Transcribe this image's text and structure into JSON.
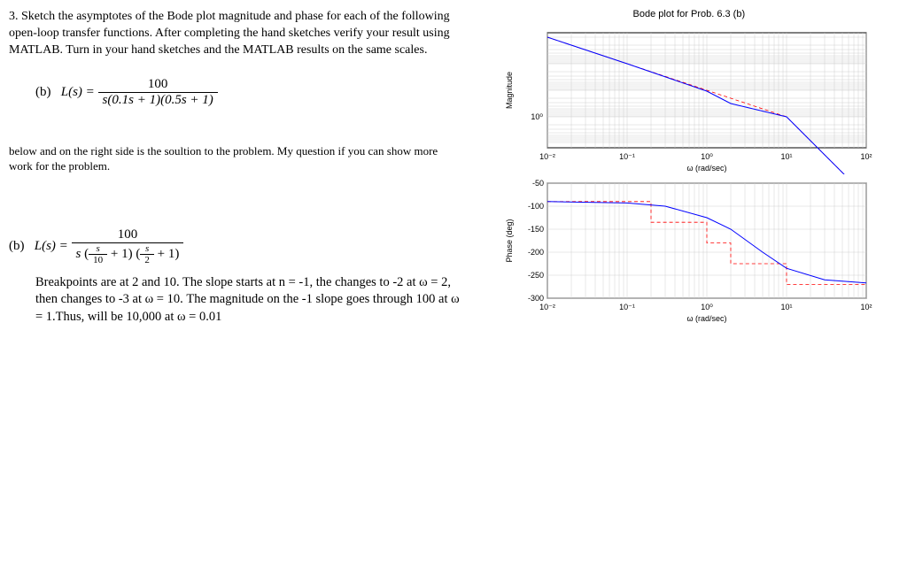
{
  "problem": {
    "number": "3.",
    "text": "Sketch the asymptotes of the Bode plot magnitude and phase for each of the following open-loop transfer functions. After completing the hand sketches verify your result using MATLAB. Turn in your hand sketches and the MATLAB results on the same scales.",
    "part_label": "(b)",
    "lhs": "L(s) = ",
    "numerator": "100",
    "denominator": "s(0.1s + 1)(0.5s + 1)"
  },
  "note": "below and on the right side is the soultion to the problem. My question if you can show more work for the problem.",
  "solution": {
    "part_label": "(b)",
    "lhs": "L(s) = ",
    "numerator": "100",
    "den_s": "s",
    "den_frac1_num": "s",
    "den_frac1_den": "10",
    "den_plus1_a": " + 1",
    "den_frac2_num": "s",
    "den_frac2_den": "2",
    "den_plus1_b": " + 1",
    "text": "Breakpoints are at 2 and 10.  The slope starts at n = -1, the changes to -2 at ω = 2, then changes to -3 at ω = 10. The magnitude on the -1 slope goes through 100 at ω = 1.Thus, will be 10,000 at ω = 0.01"
  },
  "chart_data": [
    {
      "type": "line",
      "title": "Bode plot for Prob. 6.3 (b)",
      "xlabel": "ω (rad/sec)",
      "ylabel": "Magnitude",
      "xscale": "log",
      "yscale": "log",
      "xlim": [
        0.01,
        100
      ],
      "ylim": [
        0.5,
        20000
      ],
      "xticks": [
        0.01,
        0.1,
        1,
        10,
        100
      ],
      "xtick_labels": [
        "10⁻²",
        "10⁻¹",
        "10⁰",
        "10¹",
        "10²"
      ],
      "yticks": [
        1
      ],
      "ytick_labels": [
        "10⁰"
      ],
      "series": [
        {
          "name": "magnitude",
          "x": [
            0.01,
            0.1,
            1,
            2,
            10,
            100
          ],
          "y": [
            10000,
            1000,
            89,
            32,
            1,
            0.001
          ]
        },
        {
          "name": "asymptote",
          "x": [
            0.01,
            2,
            10,
            100
          ],
          "y": [
            10000,
            50,
            1,
            0.001
          ]
        }
      ]
    },
    {
      "type": "line",
      "xlabel": "ω (rad/sec)",
      "ylabel": "Phase (deg)",
      "xscale": "log",
      "yscale": "linear",
      "xlim": [
        0.01,
        100
      ],
      "ylim": [
        -300,
        -50
      ],
      "xticks": [
        0.01,
        0.1,
        1,
        10,
        100
      ],
      "xtick_labels": [
        "10⁻²",
        "10⁻¹",
        "10⁰",
        "10¹",
        "10²"
      ],
      "yticks": [
        -50,
        -100,
        -150,
        -200,
        -250,
        -300
      ],
      "series": [
        {
          "name": "phase",
          "x": [
            0.01,
            0.1,
            0.3,
            1,
            2,
            5,
            10,
            30,
            100
          ],
          "y": [
            -90,
            -93,
            -100,
            -125,
            -150,
            -200,
            -235,
            -260,
            -267
          ]
        },
        {
          "name": "asymptote",
          "x": [
            0.01,
            0.2,
            1,
            2,
            10,
            20,
            100,
            100
          ],
          "y": [
            -90,
            -90,
            -135,
            -180,
            -225,
            -270,
            -270,
            -270
          ]
        }
      ]
    }
  ]
}
